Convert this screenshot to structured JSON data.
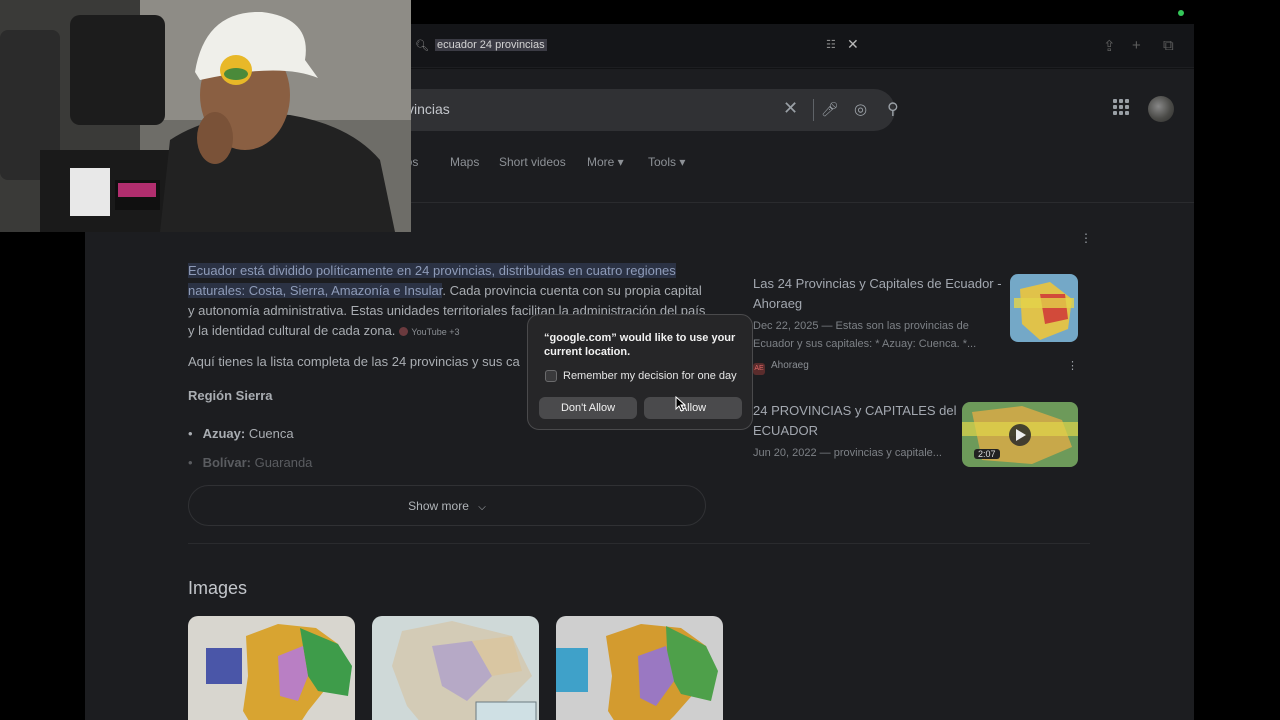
{
  "browser": {
    "address_bar": {
      "url_text": "ecuador 24 provincias"
    },
    "toolbar_icons": [
      "share-icon",
      "new-tab-icon",
      "tabs-overview-icon"
    ]
  },
  "search": {
    "query_visible": "vincias",
    "tabs": [
      "eos",
      "Maps",
      "Short videos",
      "More ▾",
      "Tools ▾"
    ]
  },
  "ai_answer": {
    "highlighted": "Ecuador está dividido políticamente en 24 provincias, distribuidas en cuatro regiones naturales: Costa, Sierra, Amazonía e Insular",
    "rest": ". Cada provincia cuenta con su propia capital y autonomía administrativa. Estas unidades territoriales facilitan la administración del país y la identidad cultural de cada zona.",
    "source_badge": "YouTube +3",
    "intro": "Aquí tienes la lista completa de las 24 provincias y sus ca",
    "region": "Región Sierra",
    "items": [
      {
        "name": "Azuay:",
        "capital": "Cuenca"
      },
      {
        "name": "Bolívar:",
        "capital": "Guaranda"
      }
    ],
    "show_more": "Show more"
  },
  "source_cards": [
    {
      "title": "Las 24 Provincias y Capitales de Ecuador - Ahoraeg",
      "snippet": "Dec 22, 2025 — Estas son las provincias de Ecuador y sus capitales: * Azuay: Cuenca. *...",
      "source": "Ahoraeg",
      "favicon": "AE"
    },
    {
      "title": "24 PROVINCIAS y CAPITALES del ECUADOR",
      "snippet": "Jun 20, 2022 — provincias y capitale...",
      "duration": "2:07"
    }
  ],
  "images": {
    "heading": "Images"
  },
  "permission_dialog": {
    "title": "“google.com” would like to use your current location.",
    "checkbox_label": "Remember my decision for one day",
    "deny": "Don't Allow",
    "allow": "Allow"
  },
  "colors": {
    "page_bg": "#1c1d20",
    "highlight_bg": "#2b3244",
    "dialog_bg": "#262628",
    "camera_indicator": "#34c759"
  }
}
